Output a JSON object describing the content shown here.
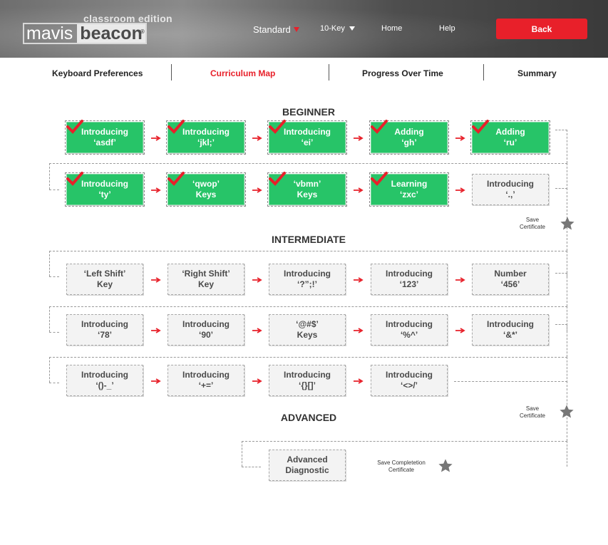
{
  "header": {
    "logo_edition": "classroom edition",
    "logo_mavis": "mavis",
    "logo_beacon": "beacon",
    "logo_reg": "®",
    "layout_select": "Standard",
    "keypad_select": "10-Key",
    "home": "Home",
    "help": "Help",
    "back": "Back"
  },
  "tabs": [
    "Keyboard Preferences",
    "Curriculum Map",
    "Progress Over Time",
    "Summary"
  ],
  "sections": {
    "beginner": "BEGINNER",
    "intermediate": "INTERMEDIATE",
    "advanced": "ADVANCED"
  },
  "beginner_lessons": [
    "Introducing\n‘asdf’",
    "Introducing\n‘jkl;’",
    "Introducing\n‘ei’",
    "Adding\n‘gh’",
    "Adding\n‘ru’",
    "Introducing\n‘ty’",
    "‘qwop’\nKeys",
    "‘vbmn’\nKeys",
    "Learning\n‘zxc’",
    "Introducing\n‘.,’"
  ],
  "intermediate_lessons": [
    "‘Left Shift’\nKey",
    "‘Right Shift’\nKey",
    "Introducing\n‘?”;!’",
    "Introducing\n‘123’",
    "Number\n‘456’",
    "Introducing\n‘78’",
    "Introducing\n‘90’",
    "‘@#$’\nKeys",
    "Introducing\n‘%^’",
    "Introducing\n‘&*’",
    "Introducing\n‘()-_’",
    "Introducing\n‘+=’",
    "Introducing\n‘{}[]’",
    "Introducing\n‘<>/’"
  ],
  "advanced_lessons": [
    "Advanced\nDiagnostic"
  ],
  "completed_lessons": 9,
  "certificates": {
    "beginner": "Save\nCertificate",
    "intermediate": "Save\nCertificate",
    "advanced": "Save Completetion\nCertificate"
  },
  "colors": {
    "accent": "#e8202a",
    "completed": "#27c468",
    "pending": "#f3f3f3",
    "star": "#777777"
  }
}
